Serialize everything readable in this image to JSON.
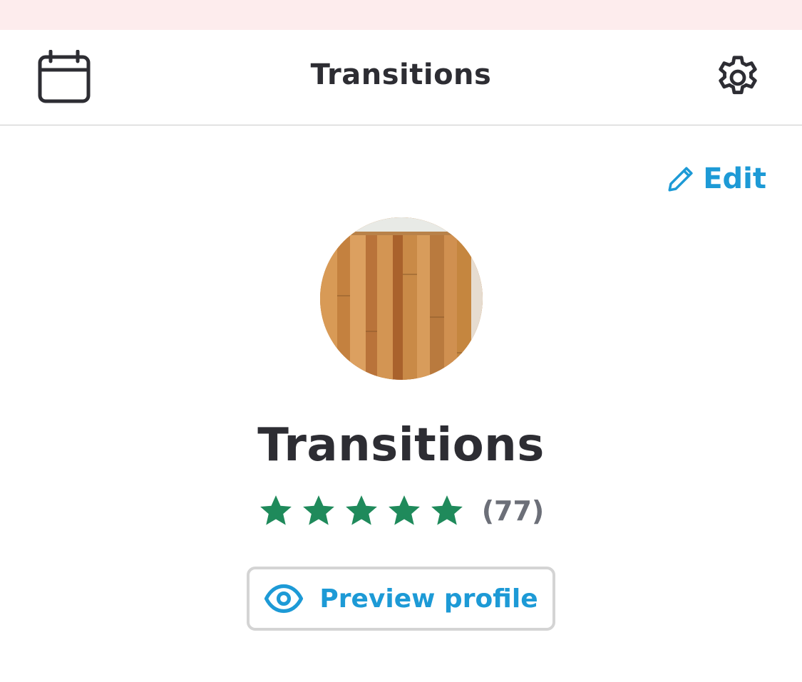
{
  "header": {
    "title": "Transitions",
    "left_icon": "calendar-icon",
    "right_icon": "gear-icon"
  },
  "profile": {
    "edit_label": "Edit",
    "edit_icon": "pencil-icon",
    "avatar": "profile-photo",
    "name": "Transitions",
    "rating": {
      "stars": 5,
      "max_stars": 5,
      "review_count_label": "(77)"
    },
    "preview_button": {
      "label": "Preview profile",
      "icon": "eye-icon"
    }
  },
  "colors": {
    "status_bar": "#fdeced",
    "accent": "#1d9ad6",
    "star": "#1f8a5b",
    "text": "#2d2d33",
    "muted": "#6c6f78"
  }
}
